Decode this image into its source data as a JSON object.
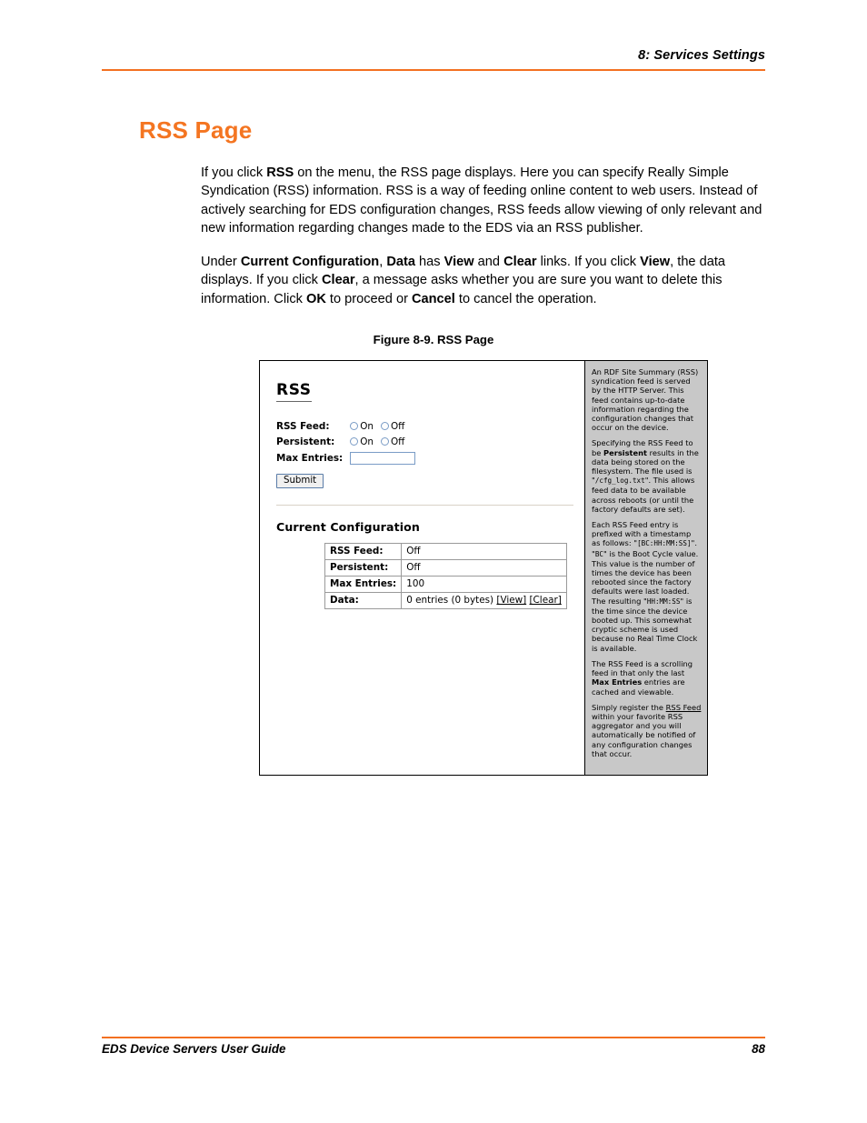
{
  "header": {
    "running_head": "8: Services Settings",
    "rule_color": "#F37021"
  },
  "section": {
    "title": "RSS Page",
    "title_color": "#F47521"
  },
  "paragraphs": {
    "p1_html": "If you click <b>RSS</b> on the menu, the RSS page displays. Here you can specify Really Simple Syndication (RSS) information. RSS is a way of feeding online content to web users. Instead of actively searching for EDS configuration changes, RSS feeds allow viewing of only relevant and new information regarding changes made to the EDS via an RSS publisher.",
    "p2_html": "Under <b>Current Configuration</b>, <b>Data</b> has <b>View</b> and <b>Clear</b> links. If you click <b>View</b>, the data displays. If you click <b>Clear</b>, a message asks whether you are sure you want to delete this information. Click <b>OK</b> to proceed or <b>Cancel</b> to cancel the operation."
  },
  "figure": {
    "caption": "Figure 8-9. RSS Page",
    "app": {
      "title": "RSS",
      "form": {
        "rss_feed_label": "RSS Feed:",
        "persistent_label": "Persistent:",
        "max_entries_label": "Max Entries:",
        "on_label": "On",
        "off_label": "Off",
        "max_entries_value": "",
        "submit_label": "Submit"
      },
      "current_configuration": {
        "heading": "Current Configuration",
        "rows": [
          {
            "key": "RSS Feed:",
            "value": "Off"
          },
          {
            "key": "Persistent:",
            "value": "Off"
          },
          {
            "key": "Max Entries:",
            "value": "100"
          }
        ],
        "data_row": {
          "key": "Data:",
          "value": "0 entries (0 bytes)",
          "view_link": "[View]",
          "clear_link": "[Clear]"
        }
      },
      "help": {
        "background": "#c8c8c8",
        "p1_html": "An RDF Site Summary (RSS) syndication feed is served by the HTTP Server. This feed contains up-to-date information regarding the configuration changes that occur on the device.",
        "p2_html": "Specifying the RSS Feed to be <b>Persistent</b> results in the data being stored on the filesystem. The file used is \"<span class='mono'>/cfg_log.txt</span>\". This allows feed data to be available across reboots (or until the factory defaults are set).",
        "p3_html": "Each RSS Feed entry is prefixed with a timestamp as follows: \"<span class='mono'>[BC:HH:MM:SS]</span>\". \"<span class='mono'>BC</span>\" is the Boot Cycle value. This value is the number of times the device has been rebooted since the factory defaults were last loaded. The resulting \"<span class='mono'>HH:MM:SS</span>\" is the time since the device booted up. This somewhat cryptic scheme is used because no Real Time Clock is available.",
        "p4_html": "The RSS Feed is a scrolling feed in that only the last <b>Max Entries</b> entries are cached and viewable.",
        "p5_html": "Simply register the <span class='ul'>RSS Feed</span> within your favorite RSS aggregator and you will automatically be notified of any configuration changes that occur."
      }
    }
  },
  "footer": {
    "title": "EDS Device Servers User Guide",
    "page_number": "88"
  }
}
